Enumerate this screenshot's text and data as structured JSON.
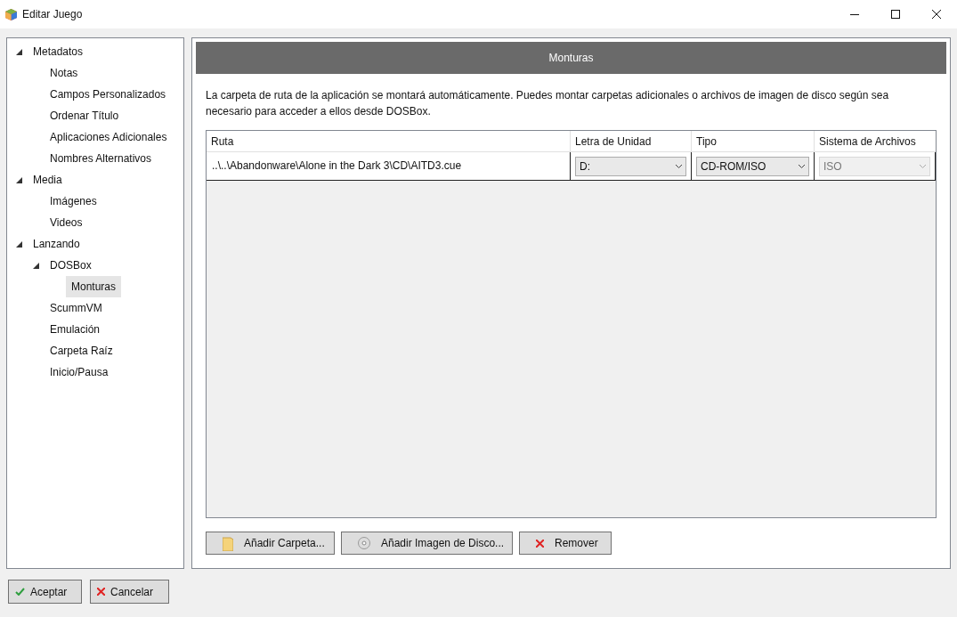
{
  "window": {
    "title": "Editar Juego"
  },
  "tree": [
    {
      "label": "Metadatos",
      "selected": false,
      "expanded": true,
      "children": [
        {
          "label": "Notas",
          "selected": false
        },
        {
          "label": "Campos Personalizados",
          "selected": false
        },
        {
          "label": "Ordenar Título",
          "selected": false
        },
        {
          "label": "Aplicaciones Adicionales",
          "selected": false
        },
        {
          "label": "Nombres Alternativos",
          "selected": false
        }
      ]
    },
    {
      "label": "Media",
      "selected": false,
      "expanded": true,
      "children": [
        {
          "label": "Imágenes",
          "selected": false
        },
        {
          "label": "Videos",
          "selected": false
        }
      ]
    },
    {
      "label": "Lanzando",
      "selected": false,
      "expanded": true,
      "children": [
        {
          "label": "DOSBox",
          "selected": false,
          "expanded": true,
          "children": [
            {
              "label": "Monturas",
              "selected": true
            }
          ]
        },
        {
          "label": "ScummVM",
          "selected": false
        },
        {
          "label": "Emulación",
          "selected": false
        },
        {
          "label": "Carpeta Raíz",
          "selected": false
        },
        {
          "label": "Inicio/Pausa",
          "selected": false
        }
      ]
    }
  ],
  "panel": {
    "title": "Monturas",
    "description": "La carpeta de ruta de la aplicación se montará automáticamente. Puedes montar carpetas adicionales o archivos de imagen de disco según sea necesario para acceder a ellos desde DOSBox."
  },
  "table": {
    "columns": [
      "Ruta",
      "Letra de Unidad",
      "Tipo",
      "Sistema de Archivos"
    ],
    "rows": [
      {
        "path": "..\\..\\Abandonware\\Alone in the Dark 3\\CD\\AITD3.cue",
        "drive": {
          "value": "D:",
          "disabled": false
        },
        "type": {
          "value": "CD-ROM/ISO",
          "disabled": false
        },
        "filesystem": {
          "value": "ISO",
          "disabled": true
        }
      }
    ]
  },
  "actions": [
    {
      "label": "Añadir Carpeta...",
      "kind": "folder"
    },
    {
      "label": "Añadir Imagen de Disco...",
      "kind": "disc"
    },
    {
      "label": "Remover",
      "kind": "remove"
    }
  ],
  "footer": [
    {
      "label": "Aceptar",
      "kind": "ok"
    },
    {
      "label": "Cancelar",
      "kind": "cancel"
    }
  ]
}
